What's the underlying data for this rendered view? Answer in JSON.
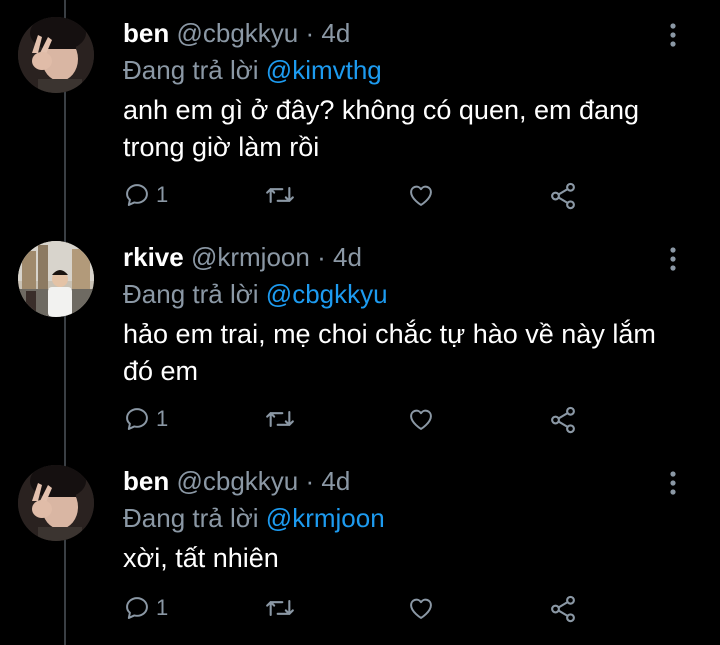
{
  "colors": {
    "background": "#000000",
    "muted": "#8b98a5",
    "mention": "#1d9bf0",
    "thread_line": "#3a3f44"
  },
  "tweets": [
    {
      "display_name": "ben",
      "handle": "@cbgkkyu",
      "separator": "·",
      "age": "4d",
      "replying_prefix": "Đang trả lời",
      "replying_to": "@kimvthg",
      "text": "anh em gì ở đây? không có quen, em đang trong giờ làm rồi",
      "reply_count": "1",
      "avatar": "ben-avatar"
    },
    {
      "display_name": "rkive",
      "handle": "@krmjoon",
      "separator": "·",
      "age": "4d",
      "replying_prefix": "Đang trả lời",
      "replying_to": "@cbgkkyu",
      "text": "hảo em trai, mẹ choi chắc tự hào về này lắm đó em",
      "reply_count": "1",
      "avatar": "rkive-avatar"
    },
    {
      "display_name": "ben",
      "handle": "@cbgkkyu",
      "separator": "·",
      "age": "4d",
      "replying_prefix": "Đang trả lời",
      "replying_to": "@krmjoon",
      "text": "xời, tất nhiên",
      "reply_count": "1",
      "avatar": "ben-avatar"
    }
  ],
  "icons": [
    "reply-icon",
    "retweet-icon",
    "like-icon",
    "share-icon",
    "more-options-icon"
  ]
}
